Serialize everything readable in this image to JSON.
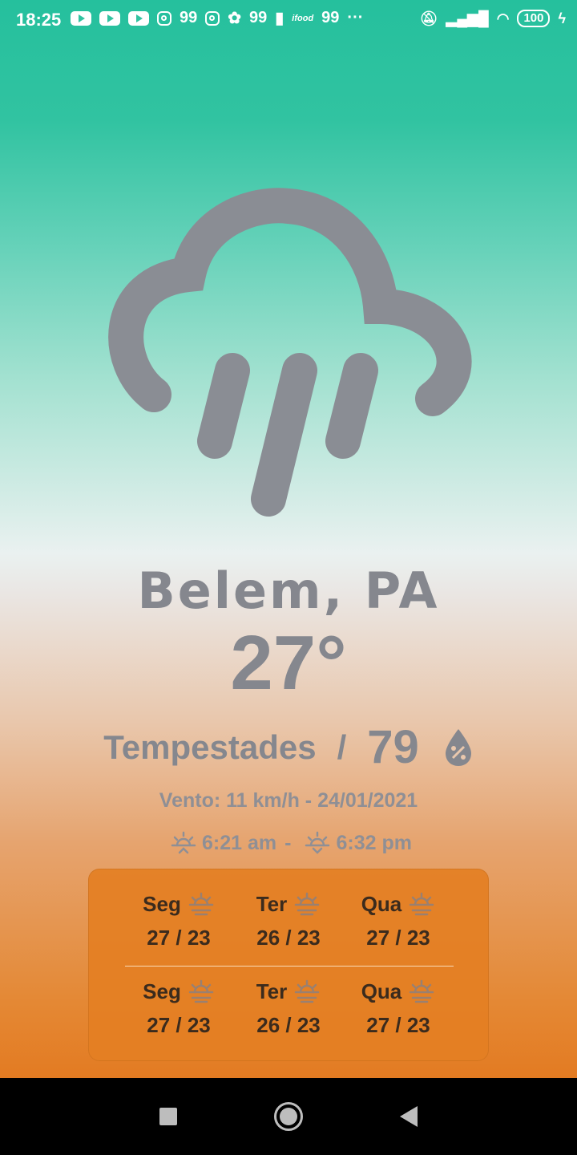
{
  "status_bar": {
    "time": "18:25",
    "notif_99_a": "99",
    "notif_99_b": "99",
    "notif_99_c": "99",
    "ifood": "ifood",
    "dots": "···",
    "battery": "100"
  },
  "weather": {
    "icon": "rain-cloud-icon",
    "city": "Belem, PA",
    "temperature": "27°",
    "condition": "Tempestades",
    "separator": "/",
    "humidity": "79",
    "wind_date": "Vento: 11 km/h  -  24/01/2021",
    "sunrise": "6:21 am",
    "sun_separator": "-",
    "sunset": "6:32 pm"
  },
  "forecast": {
    "rows": [
      [
        {
          "day": "Seg",
          "temps": "27  /  23"
        },
        {
          "day": "Ter",
          "temps": "26  /  23"
        },
        {
          "day": "Qua",
          "temps": "27  /  23"
        }
      ],
      [
        {
          "day": "Seg",
          "temps": "27  /  23"
        },
        {
          "day": "Ter",
          "temps": "26  /  23"
        },
        {
          "day": "Qua",
          "temps": "27  /  23"
        }
      ]
    ]
  },
  "colors": {
    "gradient_top": "#25c09d",
    "gradient_mid": "#eaf1f0",
    "gradient_bottom": "#e37b22",
    "text_gray": "#85878e",
    "card_orange": "#e47f23"
  }
}
